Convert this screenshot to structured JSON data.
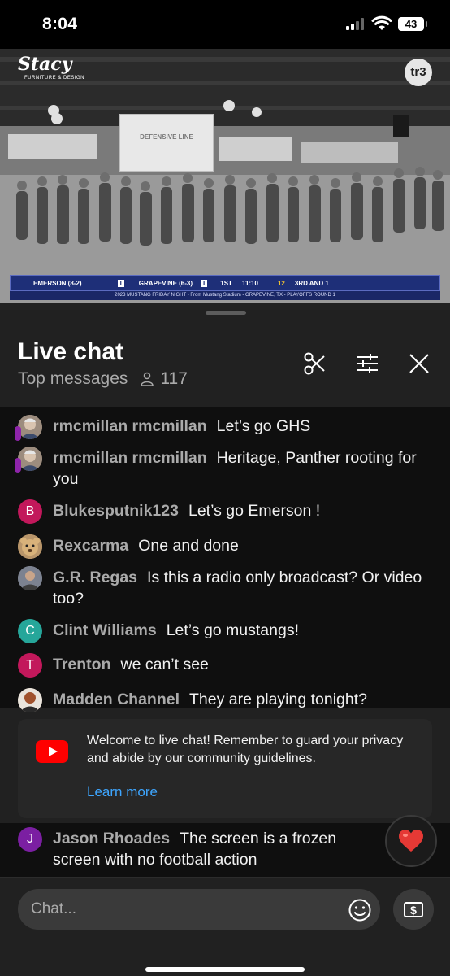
{
  "status_bar": {
    "time": "8:04",
    "battery": "43"
  },
  "video": {
    "brand_logo": "Stacy",
    "brand_tagline": "FURNITURE & DESIGN",
    "network_logo": "tr3",
    "gym_banner": "DEFENSIVE LINE",
    "scorebug": {
      "home_team": "EMERSON (8-2)",
      "home_score": "I",
      "away_team": "GRAPEVINE (6-3)",
      "away_score": "I",
      "quarter": "1ST",
      "clock": "11:10",
      "play_clock": "12",
      "down": "3RD AND 1",
      "strip": "2023 MUSTANG FRIDAY NIGHT - From Mustang Stadium - GRAPEVINE, TX - PLAYOFFS ROUND 1"
    }
  },
  "chat": {
    "title": "Live chat",
    "mode": "Top messages",
    "viewer_count": "117",
    "icons": {
      "clip": "scissors-icon",
      "filter": "sliders-icon",
      "close": "close-icon",
      "viewers": "person-icon"
    },
    "messages": [
      {
        "author": "rmcmillan rmcmillan",
        "text": "Let’s go GHS",
        "avatar_color": "#8a7a6a",
        "member": true
      },
      {
        "author": "rmcmillan rmcmillan",
        "text": "Heritage, Panther rooting for you",
        "avatar_color": "#8a7a6a",
        "member": true
      },
      {
        "author": "Blukesputnik123",
        "text": "Let’s go Emerson !",
        "avatar_letter": "B",
        "avatar_color": "#c2185b"
      },
      {
        "author": "Rexcarma",
        "text": "One and done",
        "avatar_color": "#c9a46a"
      },
      {
        "author": "G.R. Regas",
        "text": "Is this a radio only broadcast? Or video too?",
        "avatar_color": "#6b6f7a"
      },
      {
        "author": "Clint Williams",
        "text": "Let’s go mustangs!",
        "avatar_letter": "C",
        "avatar_color": "#26a69a"
      },
      {
        "author": "Trenton",
        "text": "we can’t see",
        "avatar_letter": "T",
        "avatar_color": "#c2185b"
      },
      {
        "author": "Madden Channel",
        "text": "They are playing tonight?",
        "avatar_color": "#7a5a4a"
      }
    ],
    "welcome": {
      "text": "Welcome to live chat! Remember to guard your privacy and abide by our community guidelines.",
      "link": "Learn more"
    },
    "last_message": {
      "author": "Jason Rhoades",
      "text": "The screen is a frozen screen with no football action",
      "avatar_letter": "J",
      "avatar_color": "#7b1fa2"
    },
    "input_placeholder": "Chat...",
    "reaction_icon": "heart-icon"
  }
}
